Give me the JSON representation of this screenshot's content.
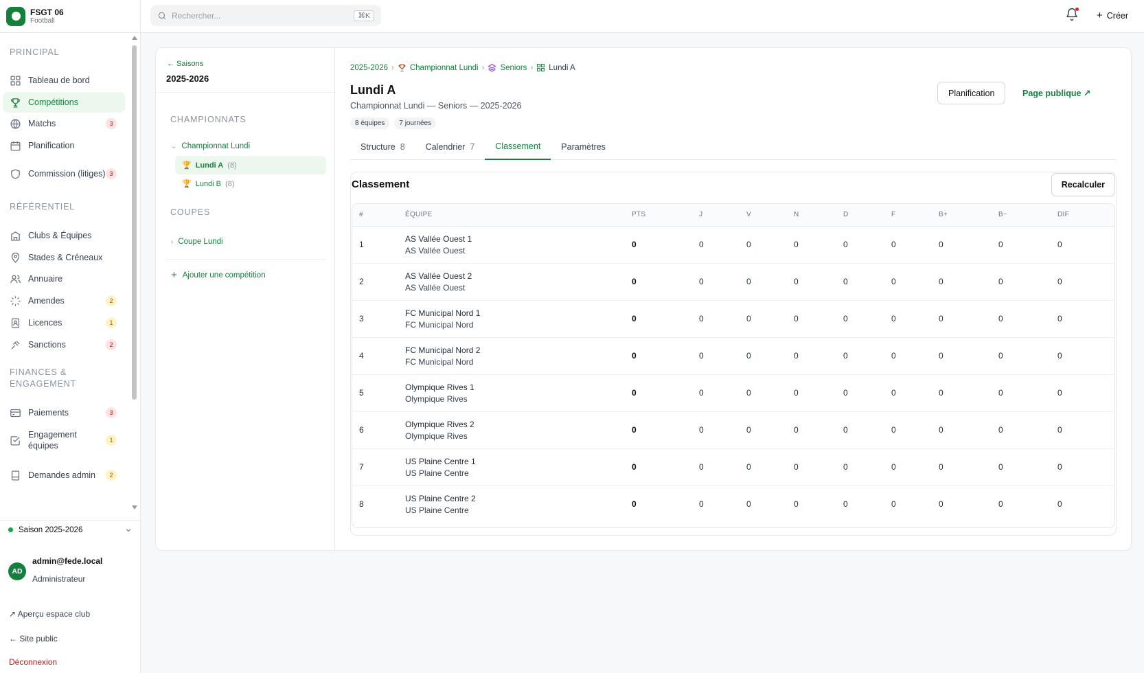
{
  "brand": {
    "name": "FSGT 06",
    "sport": "Football"
  },
  "search": {
    "placeholder": "Rechercher...",
    "shortcut": "⌘K"
  },
  "topbar": {
    "create_label": "Créer"
  },
  "sidebar": {
    "sections": {
      "principal": "PRINCIPAL",
      "referentiel": "RÉFÉRENTIEL",
      "finances": "FINANCES & ENGAGEMENT"
    },
    "items": [
      {
        "key": "tableau",
        "label": "Tableau de bord",
        "icon": "grid-icon"
      },
      {
        "key": "competitions",
        "label": "Compétitions",
        "icon": "trophy-icon",
        "active": true
      },
      {
        "key": "matchs",
        "label": "Matchs",
        "icon": "globe-icon",
        "badge": "3"
      },
      {
        "key": "planification",
        "label": "Planification",
        "icon": "calendar-icon"
      },
      {
        "key": "commission",
        "label": "Commission (litiges)",
        "icon": "shield-icon",
        "badge": "3"
      },
      {
        "key": "clubs",
        "label": "Clubs & Équipes",
        "icon": "building-icon"
      },
      {
        "key": "stades",
        "label": "Stades & Créneaux",
        "icon": "map-pin-icon"
      },
      {
        "key": "annuaire",
        "label": "Annuaire",
        "icon": "users-icon"
      },
      {
        "key": "amendes",
        "label": "Amendes",
        "icon": "loader-icon",
        "badge": "2"
      },
      {
        "key": "licences",
        "label": "Licences",
        "icon": "id-card-icon",
        "badge": "1"
      },
      {
        "key": "sanctions",
        "label": "Sanctions",
        "icon": "gavel-icon",
        "badge": "2"
      },
      {
        "key": "paiements",
        "label": "Paiements",
        "icon": "credit-card-icon",
        "badge": "3"
      },
      {
        "key": "engagement",
        "label": "Engagement équipes",
        "icon": "check-square-icon",
        "badge": "1"
      },
      {
        "key": "demandes",
        "label": "Demandes admin",
        "icon": "inbox-icon",
        "badge": "2"
      }
    ],
    "season_selector": "Saison 2025-2026",
    "user": {
      "initials": "AD",
      "email": "admin@fede.local",
      "role": "Administrateur"
    },
    "links": {
      "club_preview": "↗ Aperçu espace club",
      "public_site": "← Site public",
      "logout": "Déconnexion"
    }
  },
  "competitions_pane": {
    "back_label": "← Saisons",
    "season": "2025-2026",
    "championnats_title": "CHAMPIONNATS",
    "championnat": "Championnat Lundi",
    "divisions": [
      {
        "label": "Lundi A",
        "count": "(8)",
        "active": true
      },
      {
        "label": "Lundi B",
        "count": "(8)",
        "active": false
      }
    ],
    "coupes_title": "COUPES",
    "coupe": "Coupe Lundi",
    "add_label": "Ajouter une compétition"
  },
  "breadcrumb": {
    "season": "2025-2026",
    "championnat": "Championnat Lundi",
    "category": "Seniors",
    "division": "Lundi A"
  },
  "page": {
    "title": "Lundi A",
    "subtitle": "Championnat Lundi — Seniors — 2025-2026",
    "pills": [
      "8 équipes",
      "7 journées"
    ],
    "planification_button": "Planification",
    "public_page_link": "Page publique ↗"
  },
  "tabs": [
    {
      "label": "Structure",
      "count": "8"
    },
    {
      "label": "Calendrier",
      "count": "7"
    },
    {
      "label": "Classement",
      "count": "",
      "active": true
    },
    {
      "label": "Paramètres",
      "count": ""
    }
  ],
  "standings": {
    "title": "Classement",
    "recalc_button": "Recalculer",
    "columns": [
      "#",
      "ÉQUIPE",
      "PTS",
      "J",
      "V",
      "N",
      "D",
      "F",
      "B+",
      "B−",
      "DIF"
    ],
    "rows": [
      {
        "rank": "1",
        "team": "AS Vallée Ouest 1",
        "club": "AS Vallée Ouest",
        "pts": "0",
        "j": "0",
        "v": "0",
        "n": "0",
        "d": "0",
        "f": "0",
        "bp": "0",
        "bm": "0",
        "dif": "0"
      },
      {
        "rank": "2",
        "team": "AS Vallée Ouest 2",
        "club": "AS Vallée Ouest",
        "pts": "0",
        "j": "0",
        "v": "0",
        "n": "0",
        "d": "0",
        "f": "0",
        "bp": "0",
        "bm": "0",
        "dif": "0"
      },
      {
        "rank": "3",
        "team": "FC Municipal Nord 1",
        "club": "FC Municipal Nord",
        "pts": "0",
        "j": "0",
        "v": "0",
        "n": "0",
        "d": "0",
        "f": "0",
        "bp": "0",
        "bm": "0",
        "dif": "0"
      },
      {
        "rank": "4",
        "team": "FC Municipal Nord 2",
        "club": "FC Municipal Nord",
        "pts": "0",
        "j": "0",
        "v": "0",
        "n": "0",
        "d": "0",
        "f": "0",
        "bp": "0",
        "bm": "0",
        "dif": "0"
      },
      {
        "rank": "5",
        "team": "Olympique Rives 1",
        "club": "Olympique Rives",
        "pts": "0",
        "j": "0",
        "v": "0",
        "n": "0",
        "d": "0",
        "f": "0",
        "bp": "0",
        "bm": "0",
        "dif": "0"
      },
      {
        "rank": "6",
        "team": "Olympique Rives 2",
        "club": "Olympique Rives",
        "pts": "0",
        "j": "0",
        "v": "0",
        "n": "0",
        "d": "0",
        "f": "0",
        "bp": "0",
        "bm": "0",
        "dif": "0"
      },
      {
        "rank": "7",
        "team": "US Plaine Centre 1",
        "club": "US Plaine Centre",
        "pts": "0",
        "j": "0",
        "v": "0",
        "n": "0",
        "d": "0",
        "f": "0",
        "bp": "0",
        "bm": "0",
        "dif": "0"
      },
      {
        "rank": "8",
        "team": "US Plaine Centre 2",
        "club": "US Plaine Centre",
        "pts": "0",
        "j": "0",
        "v": "0",
        "n": "0",
        "d": "0",
        "f": "0",
        "bp": "0",
        "bm": "0",
        "dif": "0"
      }
    ]
  },
  "colors": {
    "accent": "#15803d",
    "accent_bg": "#ecf8ee",
    "badge_red": "#fde2e2",
    "badge_yellow": "#fdf3c7"
  }
}
